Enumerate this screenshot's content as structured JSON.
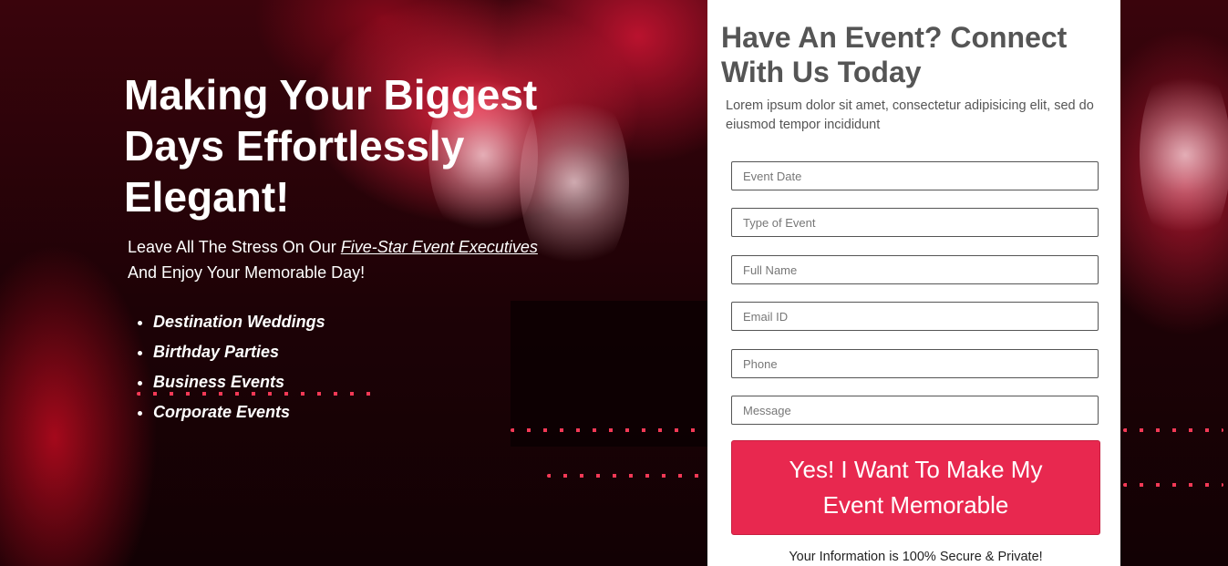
{
  "hero": {
    "title": "Making Your Biggest Days Effortlessly Elegant!",
    "subtitle_prefix": "Leave All The Stress On Our ",
    "subtitle_highlight": "Five-Star Event Executives",
    "subtitle_suffix": "And Enjoy Your Memorable Day!",
    "list": [
      "Destination Weddings",
      "Birthday Parties",
      "Business Events",
      "Corporate Events"
    ]
  },
  "form": {
    "title": "Have An Event? Connect With Us Today",
    "description": "Lorem ipsum dolor sit amet, consectetur adipisicing elit, sed do eiusmod tempor incididunt",
    "fields": {
      "event_date": "Event Date",
      "event_type": "Type of Event",
      "full_name": "Full Name",
      "email": "Email ID",
      "phone": "Phone",
      "message": "Message"
    },
    "submit_label": "Yes! I Want To Make My Event Memorable",
    "secure_note": "Your Information is 100% Secure & Private!"
  },
  "colors": {
    "accent": "#e8284f",
    "panel_bg": "#ffffff",
    "heading": "#555555"
  }
}
